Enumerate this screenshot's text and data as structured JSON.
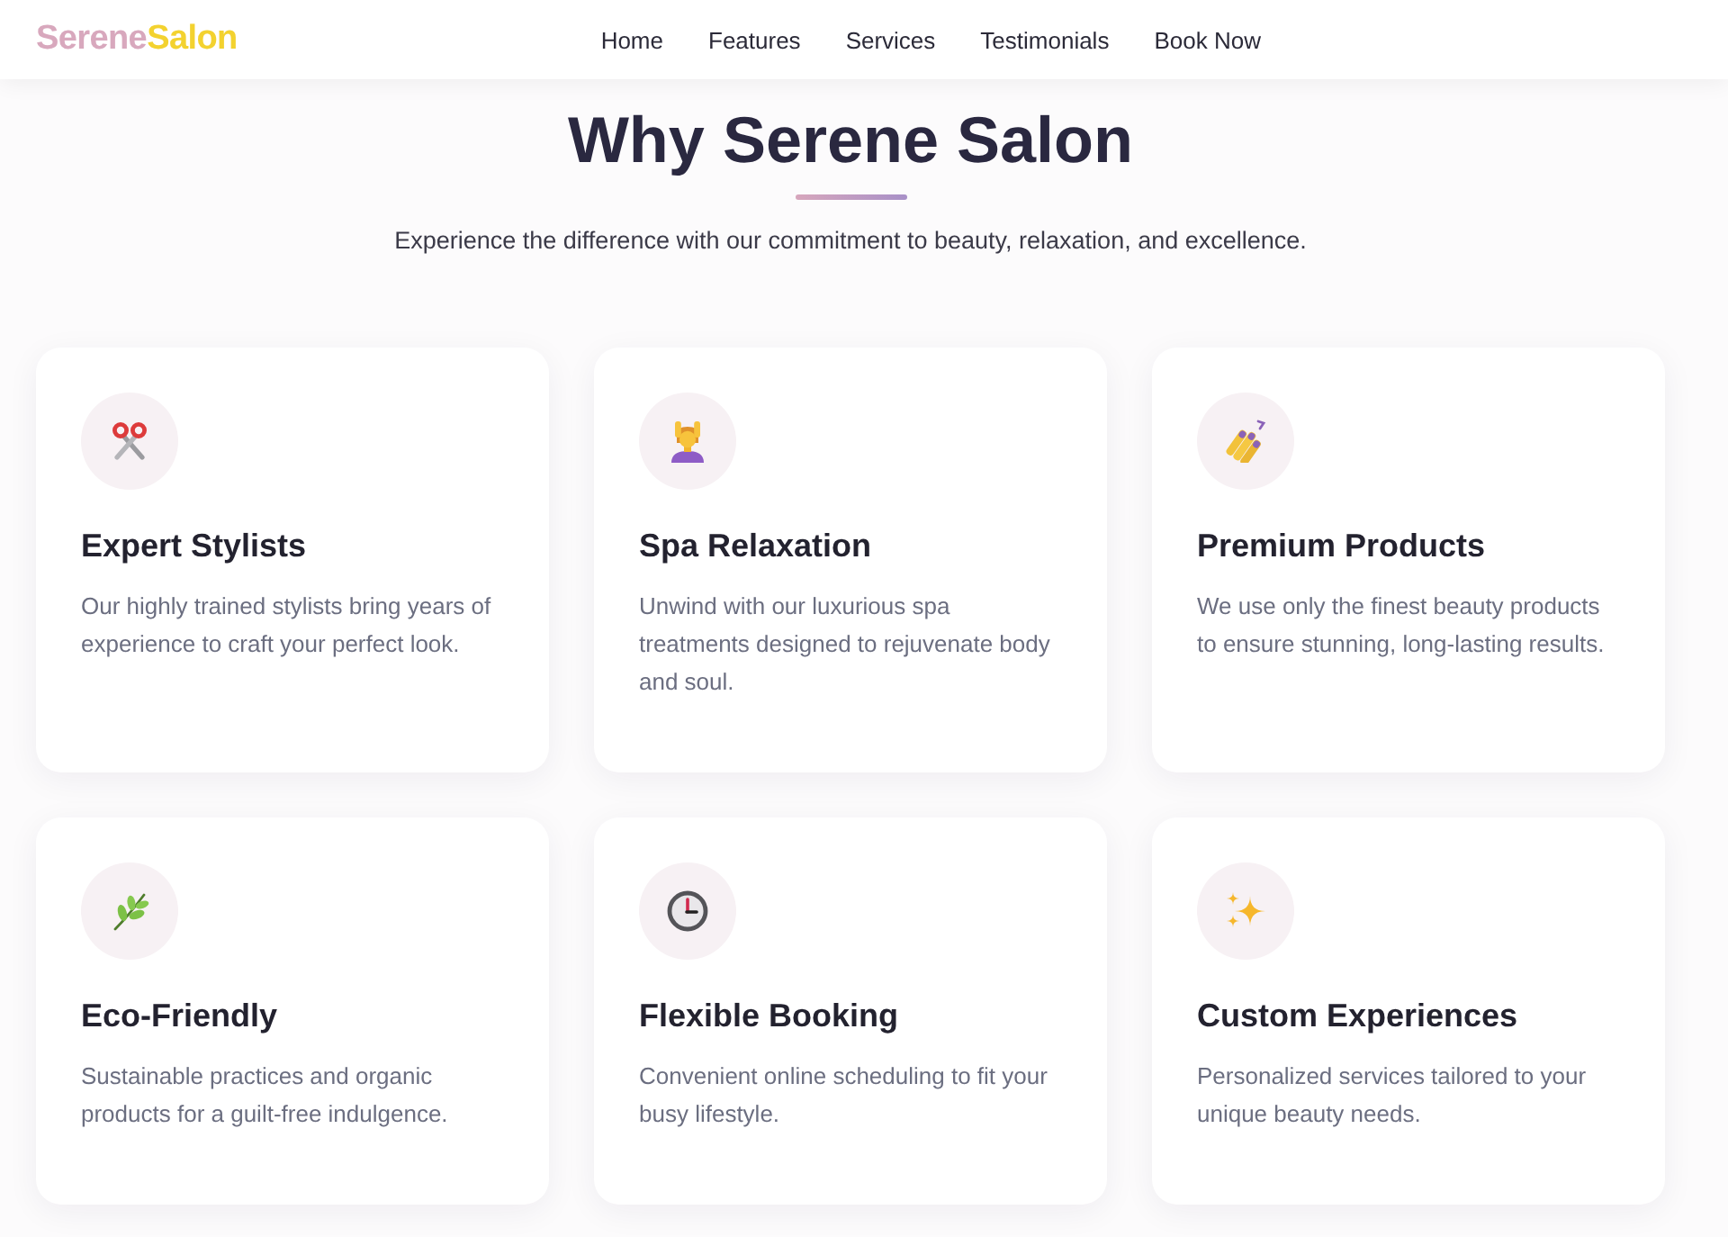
{
  "header": {
    "logo": {
      "name_start": "Serene",
      "name_end": "Salon"
    },
    "nav": [
      {
        "label": "Home"
      },
      {
        "label": "Features"
      },
      {
        "label": "Services"
      },
      {
        "label": "Testimonials"
      },
      {
        "label": "Book Now"
      }
    ]
  },
  "section": {
    "title": "Why Serene Salon",
    "subtitle": "Experience the difference with our commitment to beauty, relaxation, and excellence."
  },
  "features": [
    {
      "kind": "scissors",
      "title": "Expert Stylists",
      "description": "Our highly trained stylists bring years of experience to craft your perfect look."
    },
    {
      "kind": "massage",
      "title": "Spa Relaxation",
      "description": "Unwind with our luxurious spa treatments designed to rejuvenate body and soul."
    },
    {
      "kind": "nail-polish",
      "title": "Premium Products",
      "description": "We use only the finest beauty products to ensure stunning, long-lasting results."
    },
    {
      "kind": "herb",
      "title": "Eco-Friendly",
      "description": "Sustainable practices and organic products for a guilt-free indulgence."
    },
    {
      "kind": "clock",
      "title": "Flexible Booking",
      "description": "Convenient online scheduling to fit your busy lifestyle."
    },
    {
      "kind": "sparkles",
      "title": "Custom Experiences",
      "description": "Personalized services tailored to your unique beauty needs."
    }
  ]
}
